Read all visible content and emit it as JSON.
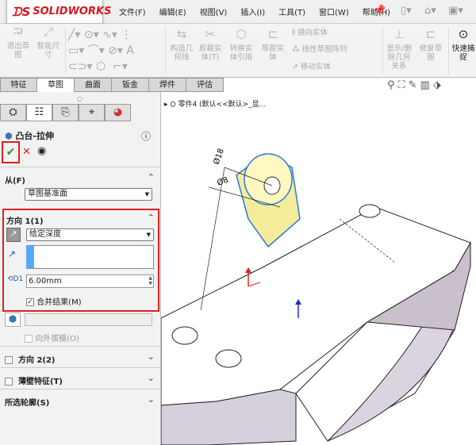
{
  "app": {
    "logo": "SOLIDWORKS"
  },
  "menu": [
    "文件(F)",
    "编辑(E)",
    "视图(V)",
    "插入(I)",
    "工具(T)",
    "窗口(W)",
    "帮助(H)"
  ],
  "toolbar": {
    "exit_sketch": "退出草图",
    "smart_dim": "智能尺寸",
    "construction": "构造几何线",
    "trim": "剪裁实体(T)",
    "convert": "转换实体引用",
    "offset": "等距实体",
    "mirror": "镜向实体",
    "linear_pattern": "线性草图阵列",
    "move": "移动实体",
    "relations": "显示/删除几何关系",
    "repair": "修复草图",
    "quick_snap": "快速捕捉"
  },
  "tabs": [
    "特征",
    "草图",
    "曲面",
    "钣金",
    "焊件",
    "评估"
  ],
  "panel": {
    "title": "凸台-拉伸",
    "from": {
      "label": "从(F)",
      "value": "草图基准面"
    },
    "dir1": {
      "label": "方向 1(1)",
      "end_condition": "给定深度",
      "depth": "6.00mm",
      "merge_label": "合并结果(M)",
      "merge_checked": true
    },
    "draft_outward": "向外拔模(O)",
    "dir2": {
      "label": "方向 2(2)"
    },
    "thin": {
      "label": "薄壁特征(T)"
    },
    "contours": {
      "label": "所选轮廓(S)"
    }
  },
  "viewport": {
    "tree_label": "零件4 (默认<<默认>_显...",
    "dim1": "Ø18",
    "dim2": "Ø8"
  }
}
